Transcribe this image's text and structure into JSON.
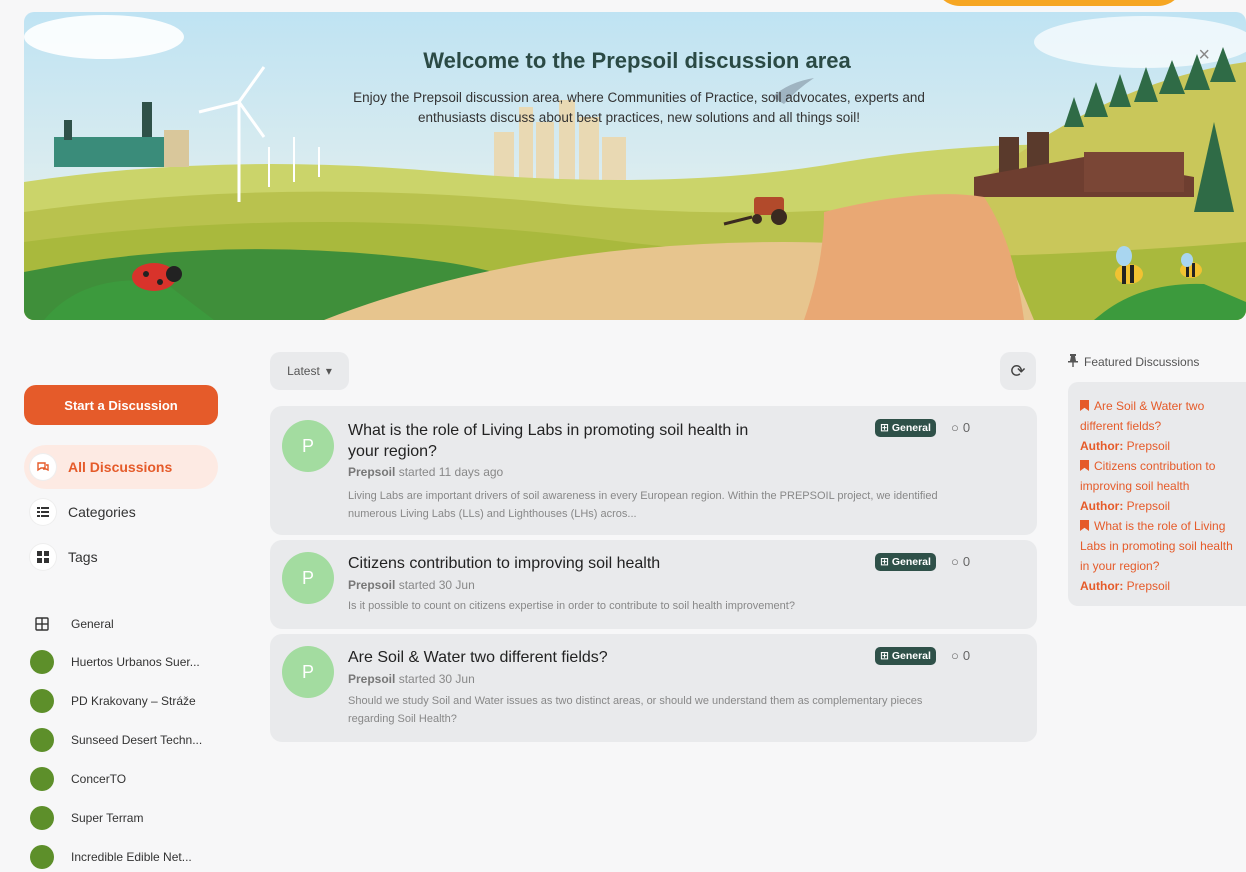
{
  "hero": {
    "title": "Welcome to the Prepsoil discussion area",
    "description": "Enjoy the Prepsoil discussion area, where Communities of Practice, soil advocates, experts and enthusiasts discuss about best practices, new solutions and all things soil!",
    "close_label": "×"
  },
  "sidebar": {
    "start_label": "Start a Discussion",
    "nav": [
      {
        "label": "All Discussions",
        "icon": "chat-bubbles-icon"
      },
      {
        "label": "Categories",
        "icon": "list-icon"
      },
      {
        "label": "Tags",
        "icon": "grid-icon"
      }
    ],
    "categories": [
      {
        "label": "General",
        "icon": "grid-icon"
      },
      {
        "label": "Huertos Urbanos Suer..."
      },
      {
        "label": "PD Krakovany – Stráže"
      },
      {
        "label": "Sunseed Desert Techn..."
      },
      {
        "label": "ConcerTO"
      },
      {
        "label": "Super Terram"
      },
      {
        "label": "Incredible Edible Net..."
      }
    ],
    "category_color": "#5d8f2a"
  },
  "toolbar": {
    "sort_label": "Latest",
    "refresh_icon": "refresh-icon"
  },
  "discussions": [
    {
      "title": "What is the role of Living Labs in promoting soil health in your region?",
      "avatar_letter": "P",
      "author": "Prepsoil",
      "started": "started 11 days ago",
      "excerpt": "Living Labs are important drivers of soil awareness in every European region. Within the PREPSOIL project, we identified numerous Living Labs (LLs) and Lighthouses (LHs) acros...",
      "tag": "General",
      "replies": "0"
    },
    {
      "title": "Citizens contribution to improving soil health",
      "avatar_letter": "P",
      "author": "Prepsoil",
      "started": "started 30 Jun",
      "excerpt": "Is it possible to count on citizens expertise in order to contribute to soil health improvement?",
      "tag": "General",
      "replies": "0"
    },
    {
      "title": "Are Soil & Water two different fields?",
      "avatar_letter": "P",
      "author": "Prepsoil",
      "started": "started 30 Jun",
      "excerpt": "Should we study Soil and Water issues as two distinct areas, or should we understand them as complementary pieces regarding Soil Health?",
      "tag": "General",
      "replies": "0"
    }
  ],
  "featured": {
    "heading": "Featured Discussions",
    "author_label": "Author:",
    "items": [
      {
        "title": "Are Soil & Water two different fields?",
        "author": "Prepsoil"
      },
      {
        "title": "Citizens contribution to improving soil health",
        "author": "Prepsoil"
      },
      {
        "title": "What is the role of Living Labs in promoting soil health in your region?",
        "author": "Prepsoil"
      }
    ]
  },
  "colors": {
    "accent": "#e55b2a",
    "tag_bg": "#2f5149",
    "avatar_bg": "#a3dca0",
    "active_nav_bg": "#fdeae3"
  }
}
